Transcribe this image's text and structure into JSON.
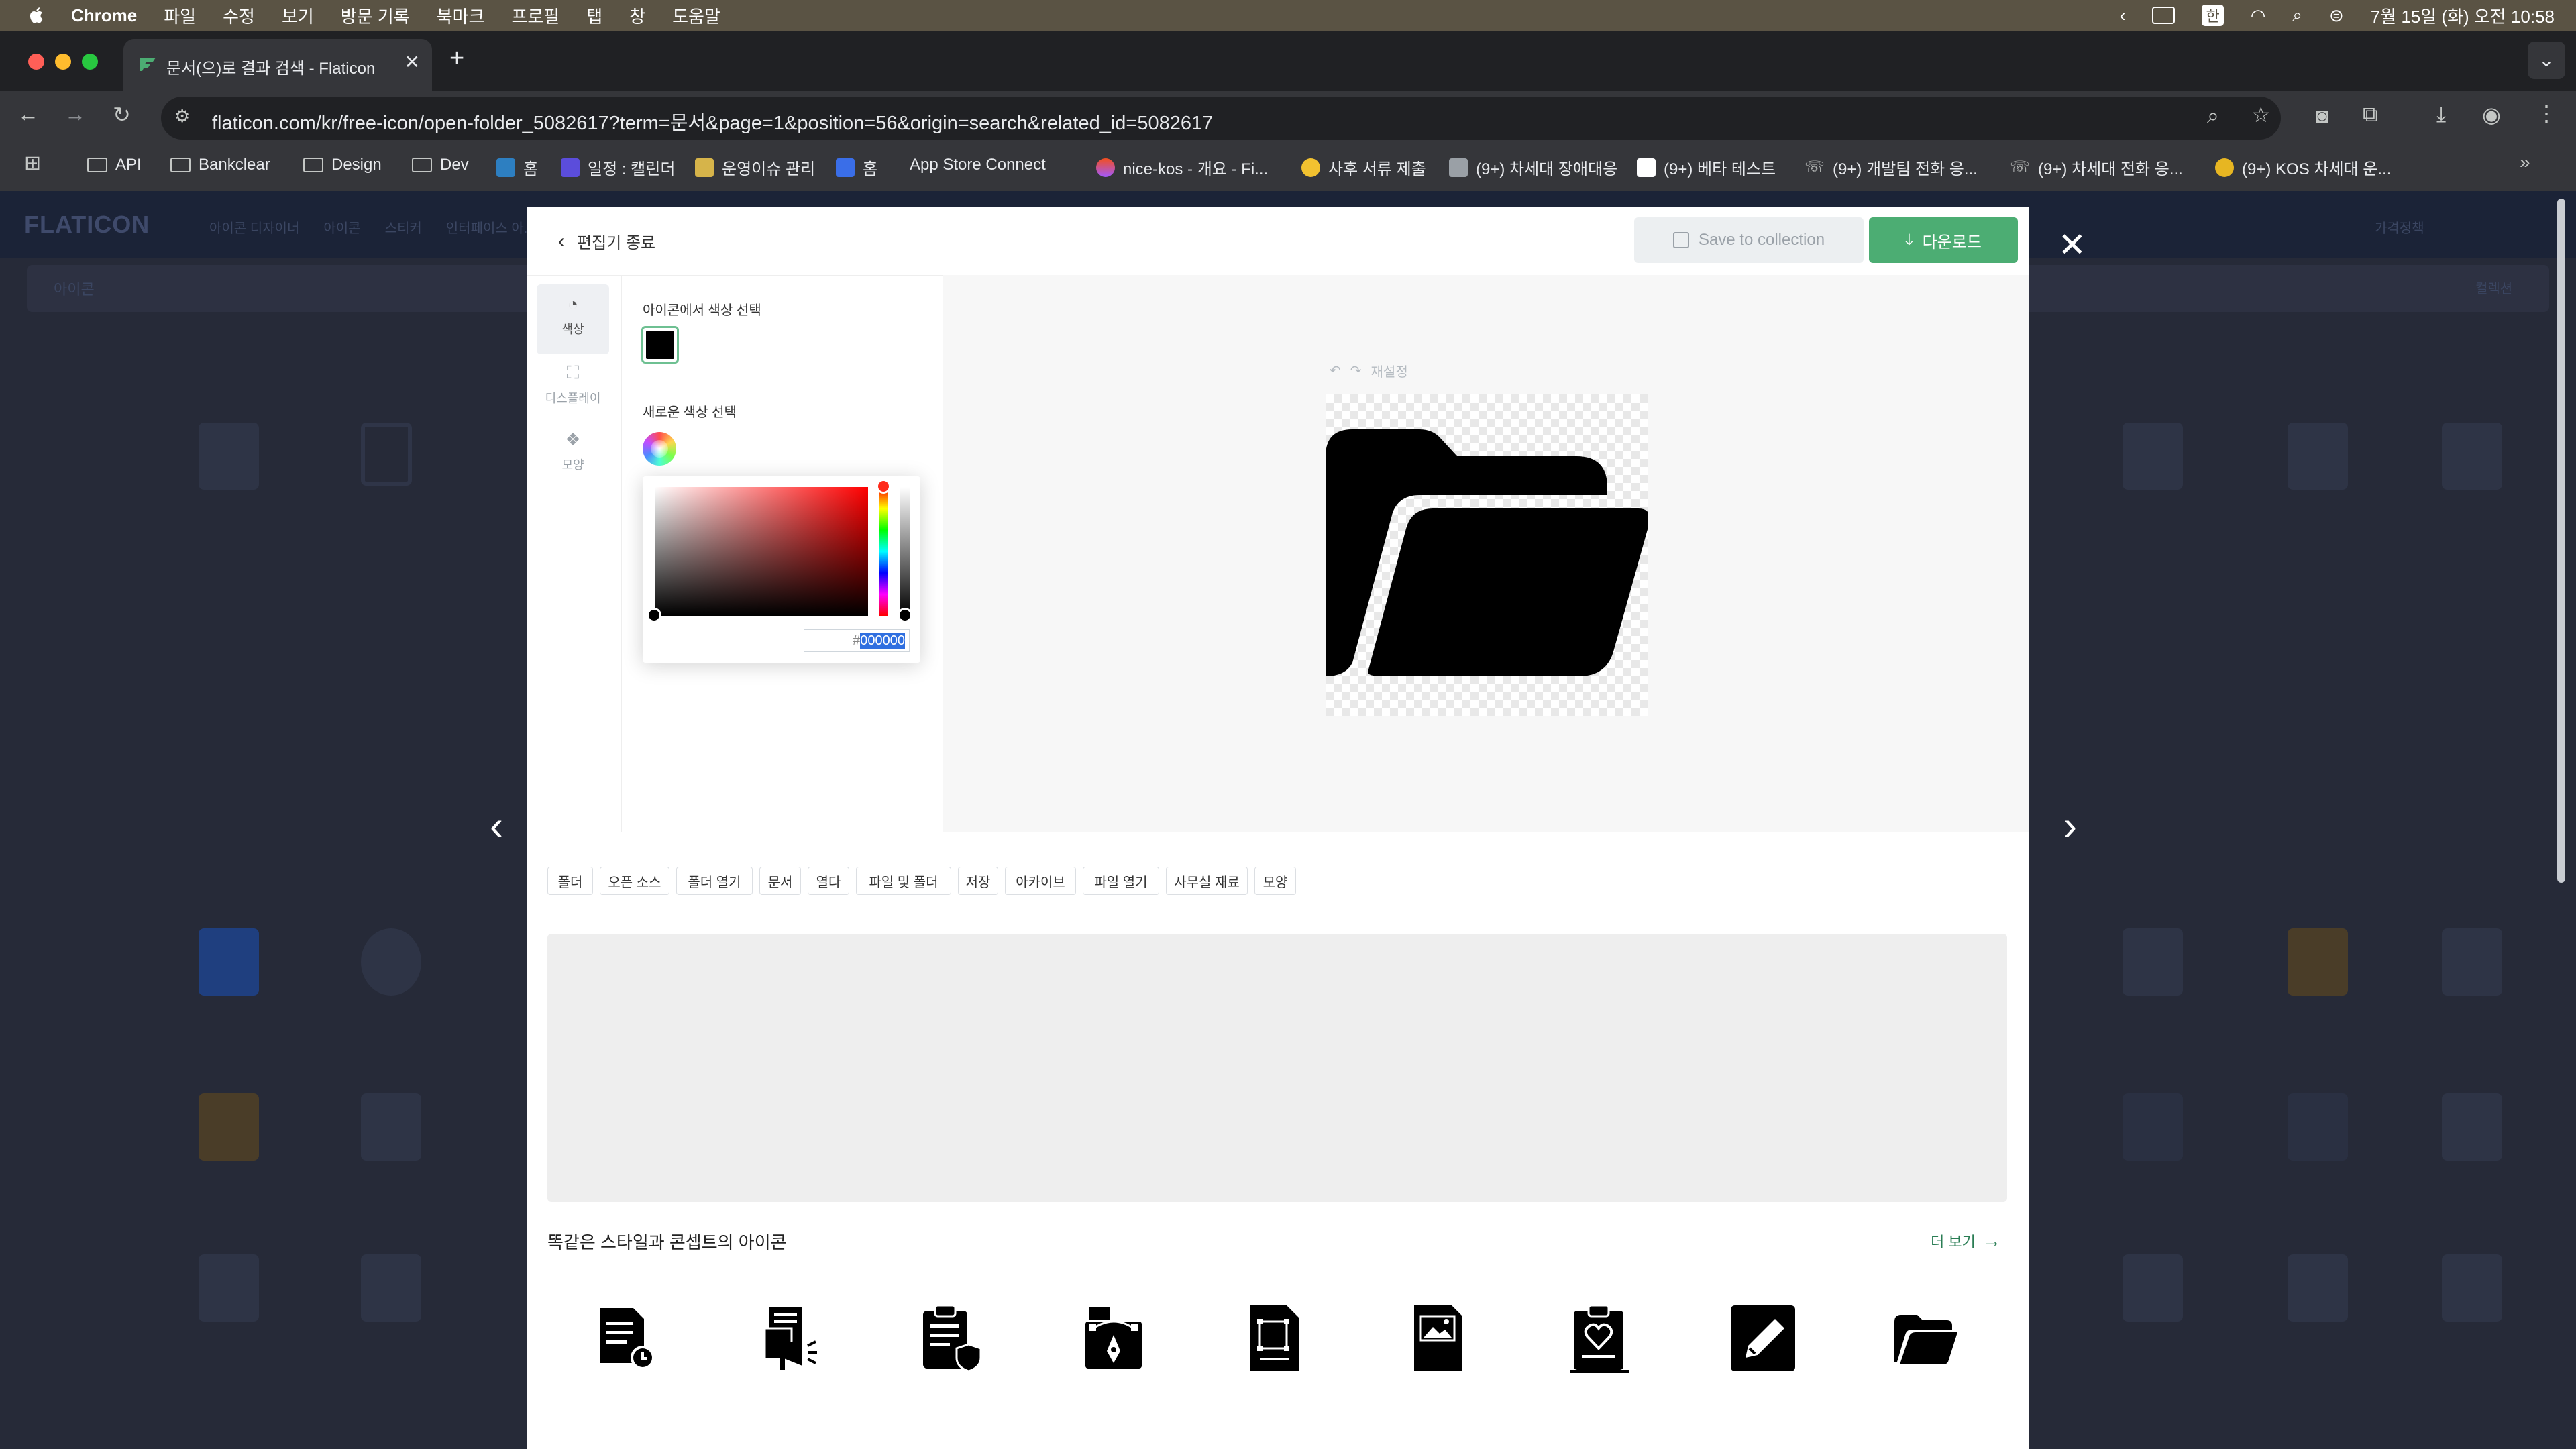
{
  "menubar": {
    "app": "Chrome",
    "items": [
      "파일",
      "수정",
      "보기",
      "방문 기록",
      "북마크",
      "프로필",
      "탭",
      "창",
      "도움말"
    ],
    "clock": "7월 15일 (화) 오전 10:58",
    "input_badge": "한"
  },
  "browser": {
    "tab_title": "문서(으)로 결과 검색 - Flaticon",
    "new_tab": "+",
    "url": "flaticon.com/kr/free-icon/open-folder_5082617?term=문서&page=1&position=56&origin=search&related_id=5082617",
    "bookmarks": [
      {
        "label": "API",
        "icon": "folder-icon"
      },
      {
        "label": "Bankclear",
        "icon": "folder-icon"
      },
      {
        "label": "Design",
        "icon": "folder-icon"
      },
      {
        "label": "Dev",
        "icon": "folder-icon"
      },
      {
        "label": "홈",
        "icon": "app-icon"
      },
      {
        "label": "일정 : 캘린더",
        "icon": "calendar-icon"
      },
      {
        "label": "운영이슈 관리",
        "icon": "app-icon"
      },
      {
        "label": "홈",
        "icon": "app-icon"
      },
      {
        "label": "App Store Connect",
        "icon": "apple-icon"
      },
      {
        "label": "nice-kos - 개요 - Fi...",
        "icon": "figma-icon"
      },
      {
        "label": "사후 서류 제출",
        "icon": "app-icon"
      },
      {
        "label": "(9+) 차세대 장애대응",
        "icon": "app-icon"
      },
      {
        "label": "(9+) 베타 테스트",
        "icon": "notion-icon"
      },
      {
        "label": "(9+) 개발팀 전화 응...",
        "icon": "phone-icon"
      },
      {
        "label": "(9+) 차세대 전화 응...",
        "icon": "phone-icon"
      },
      {
        "label": "(9+) KOS 차세대 운...",
        "icon": "app-icon"
      }
    ]
  },
  "background_page": {
    "logo": "FLATICON",
    "search_type": "아이콘",
    "nav_items": [
      "아이콘 디자이너",
      "아이콘",
      "스티커",
      "인터페이스 아..."
    ],
    "pricing": "가격정책",
    "profile": "컬렉션"
  },
  "editor": {
    "exit_label": "편집기 종료",
    "save_label": "Save to collection",
    "download_label": "다운로드",
    "rail": [
      {
        "label": "색상",
        "icon": "palette-icon"
      },
      {
        "label": "디스플레이",
        "icon": "resize-icon"
      },
      {
        "label": "모양",
        "icon": "shapes-icon"
      }
    ],
    "pick_from_icon_label": "아이콘에서 색상 선택",
    "new_color_label": "새로운 색상 선택",
    "current_color": "#000000",
    "hex_prefix": "#",
    "hex_value": "000000",
    "reset_label": "재설정"
  },
  "tags": [
    "폴더",
    "오픈 소스",
    "폴더 열기",
    "문서",
    "열다",
    "파일 및 폴더",
    "저장",
    "아카이브",
    "파일 열기",
    "사무실 재료",
    "모양"
  ],
  "related": {
    "title": "똑같은 스타일과 콘셉트의 아이콘",
    "see_more": "더 보기",
    "icons": [
      "document-clock-icon",
      "document-megaphone-icon",
      "clipboard-shield-icon",
      "vector-pen-folder-icon",
      "document-frame-icon",
      "image-file-icon",
      "clipboard-heart-icon",
      "pencil-edit-icon",
      "open-folder-icon"
    ]
  },
  "colors": {
    "accent_green": "#4cad73",
    "overlay": "#262a38"
  }
}
